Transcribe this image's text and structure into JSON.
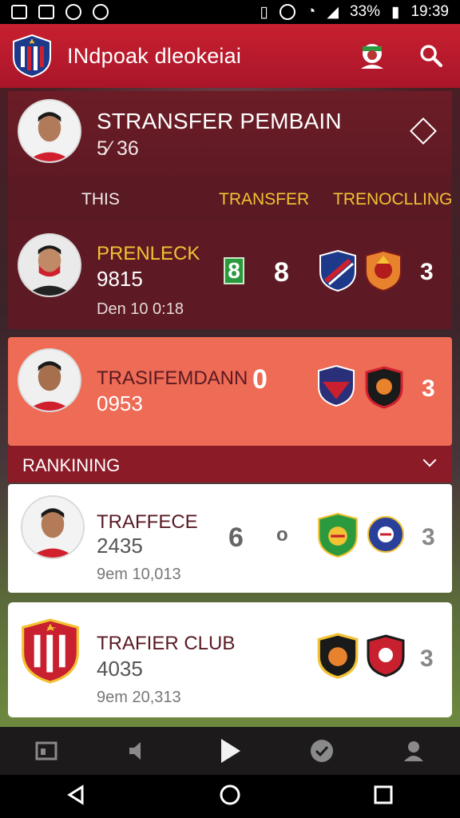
{
  "status_bar": {
    "battery": "33%",
    "time": "19:39"
  },
  "app": {
    "title": "INdpoak dleokeiai"
  },
  "transfer_card": {
    "title": "STRANSFER PEMBAIN",
    "subtitle": "5⁄ 36"
  },
  "tabs": [
    {
      "label": "THIS"
    },
    {
      "label": "TRANSFER"
    },
    {
      "label": "TRENOCLLING"
    }
  ],
  "rows": [
    {
      "name": "PRENLECK",
      "score": "9815",
      "date": "Den 10 0:18",
      "left_value": "8",
      "mid_value": "8",
      "right_value": "3"
    },
    {
      "name": "TRASIFEMDANN",
      "score": "0953",
      "left_value": "0",
      "right_value": "3"
    },
    {
      "name": "TRAFFECE",
      "score": "2435",
      "date": "9em 10,013",
      "mid_value": "6",
      "small_value": "o",
      "right_value": "3"
    },
    {
      "name": "TRAFIER CLUB",
      "score": "4035",
      "date": "9em 20,313",
      "right_value": "3"
    }
  ],
  "ranking": {
    "label": "RANKINING"
  },
  "colors": {
    "primary": "#c8202f",
    "dark": "#5d1a24",
    "highlight": "#ee6b55",
    "gold": "#f2c233"
  }
}
